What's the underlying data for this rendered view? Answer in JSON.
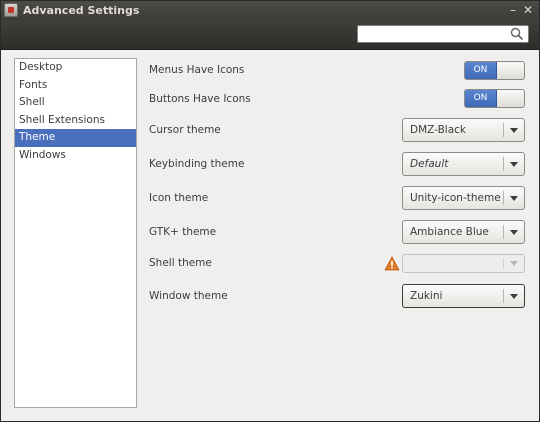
{
  "window": {
    "title": "Advanced Settings"
  },
  "controls": {
    "minimize": "–",
    "close": "✕"
  },
  "search": {
    "placeholder": "",
    "icon": "magnifier-icon"
  },
  "sidebar": {
    "items": [
      {
        "label": "Desktop",
        "selected": false
      },
      {
        "label": "Fonts",
        "selected": false
      },
      {
        "label": "Shell",
        "selected": false
      },
      {
        "label": "Shell Extensions",
        "selected": false
      },
      {
        "label": "Theme",
        "selected": true
      },
      {
        "label": "Windows",
        "selected": false
      }
    ]
  },
  "settings": {
    "menus_have_icons": {
      "label": "Menus Have Icons",
      "state": "ON"
    },
    "buttons_have_icons": {
      "label": "Buttons Have Icons",
      "state": "ON"
    },
    "cursor_theme": {
      "label": "Cursor theme",
      "value": "DMZ-Black"
    },
    "keybinding_theme": {
      "label": "Keybinding theme",
      "value": "Default"
    },
    "icon_theme": {
      "label": "Icon theme",
      "value": "Unity-icon-theme"
    },
    "gtk_theme": {
      "label": "GTK+ theme",
      "value": "Ambiance Blue"
    },
    "shell_theme": {
      "label": "Shell theme",
      "value": "",
      "warning_icon": "warning-triangle-icon"
    },
    "window_theme": {
      "label": "Window theme",
      "value": "Zukini"
    }
  },
  "colors": {
    "selection": "#4a6fbd",
    "switch_on": "#4a77c6",
    "warning": "#e07b22"
  }
}
